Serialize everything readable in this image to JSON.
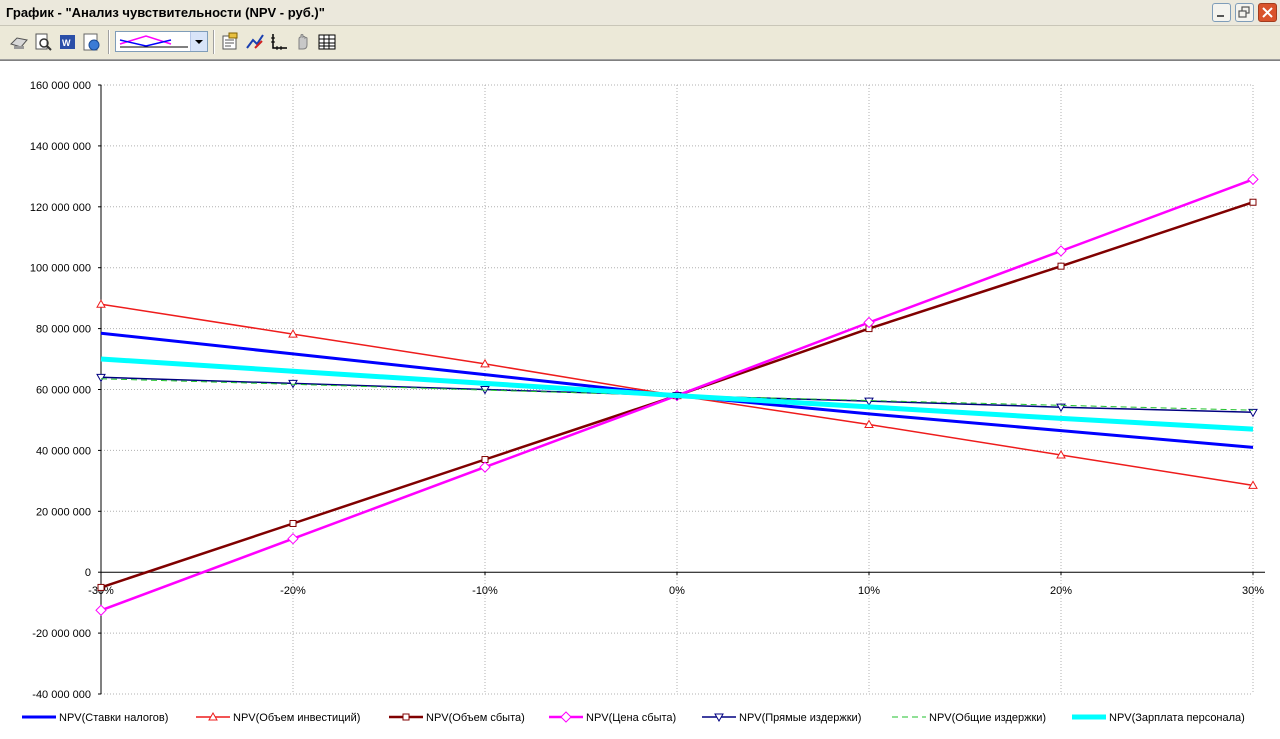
{
  "window": {
    "title": "График - \"Анализ чувствительности (NPV - руб.)\""
  },
  "toolbar": {
    "icons": [
      "print-setup-icon",
      "print-preview-icon",
      "export-word-icon",
      "export-web-icon",
      "chart-type-combo",
      "properties-icon",
      "chart-edit-icon",
      "axes-icon",
      "hand-icon",
      "table-icon"
    ]
  },
  "colors": {
    "background": "#ffffff",
    "grid": "#b0b0b0"
  },
  "chart_data": {
    "type": "line",
    "title": "",
    "xlabel": "",
    "ylabel": "",
    "categories": [
      "-30%",
      "-20%",
      "-10%",
      "0%",
      "10%",
      "20%",
      "30%"
    ],
    "x": [
      -30,
      -20,
      -10,
      0,
      10,
      20,
      30
    ],
    "ylim": [
      -40000000,
      160000000
    ],
    "yticks": [
      -40000000,
      -20000000,
      0,
      20000000,
      40000000,
      60000000,
      80000000,
      100000000,
      120000000,
      140000000,
      160000000
    ],
    "ytick_labels": [
      "-40 000 000",
      "-20 000 000",
      "0",
      "20 000 000",
      "40 000 000",
      "60 000 000",
      "80 000 000",
      "100 000 000",
      "120 000 000",
      "140 000 000",
      "160 000 000"
    ],
    "grid": true,
    "legend_position": "bottom",
    "series": [
      {
        "name": "NPV(Ставки налогов)",
        "color": "#0000ff",
        "width": 3,
        "marker": "none",
        "values": [
          78500000,
          71700000,
          64900000,
          58000000,
          52000000,
          46500000,
          41000000
        ]
      },
      {
        "name": "NPV(Объем инвестиций)",
        "color": "#ee1c1c",
        "width": 1.5,
        "marker": "triangle-up",
        "values": [
          88000000,
          78200000,
          68400000,
          58000000,
          48500000,
          38500000,
          28500000
        ]
      },
      {
        "name": "NPV(Объем сбыта)",
        "color": "#800000",
        "width": 2.5,
        "marker": "square",
        "values": [
          -5000000,
          16000000,
          37000000,
          58000000,
          80000000,
          100500000,
          121500000
        ]
      },
      {
        "name": "NPV(Цена сбыта)",
        "color": "#ff00ff",
        "width": 2.5,
        "marker": "diamond",
        "values": [
          -12500000,
          11000000,
          34500000,
          58000000,
          82000000,
          105500000,
          129000000
        ]
      },
      {
        "name": "NPV(Прямые издержки)",
        "color": "#000080",
        "width": 1.5,
        "marker": "triangle-down",
        "values": [
          64000000,
          62000000,
          60000000,
          58000000,
          56200000,
          54200000,
          52500000
        ]
      },
      {
        "name": "NPV(Общие издержки)",
        "color": "#22c22c",
        "width": 1,
        "dash": "6,4",
        "marker": "none",
        "values": [
          63500000,
          61700000,
          59800000,
          58000000,
          56400000,
          54800000,
          53200000
        ]
      },
      {
        "name": "NPV(Зарплата персонала)",
        "color": "#00ffff",
        "width": 5,
        "marker": "none",
        "values": [
          70000000,
          66000000,
          62000000,
          58000000,
          54300000,
          50500000,
          47000000
        ]
      }
    ]
  }
}
